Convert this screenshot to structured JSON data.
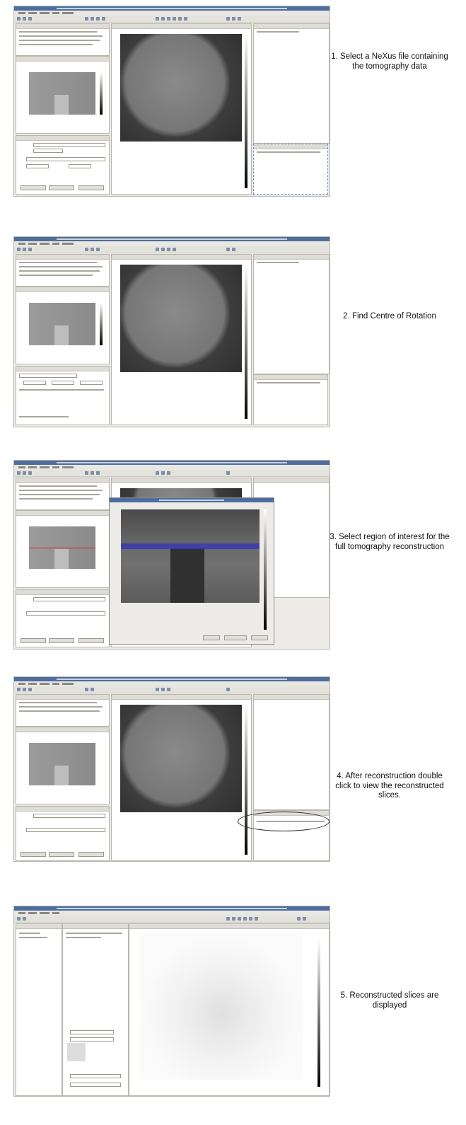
{
  "steps": [
    {
      "caption": "1. Select a NeXus file containing the tomography data"
    },
    {
      "caption": "2. Find Centre of Rotation"
    },
    {
      "caption": "3. Select region of interest for the full tomography reconstruction"
    },
    {
      "caption": "4. After reconstruction double click to view the reconstructed slices."
    },
    {
      "caption": "5. Reconstructed slices are displayed"
    }
  ],
  "colors": {
    "titlebar": "#4d6d9d",
    "roi_band": "#3a3ab4",
    "roi_line": "#cc2222",
    "highlight_dashed": "#5a8fd6"
  }
}
